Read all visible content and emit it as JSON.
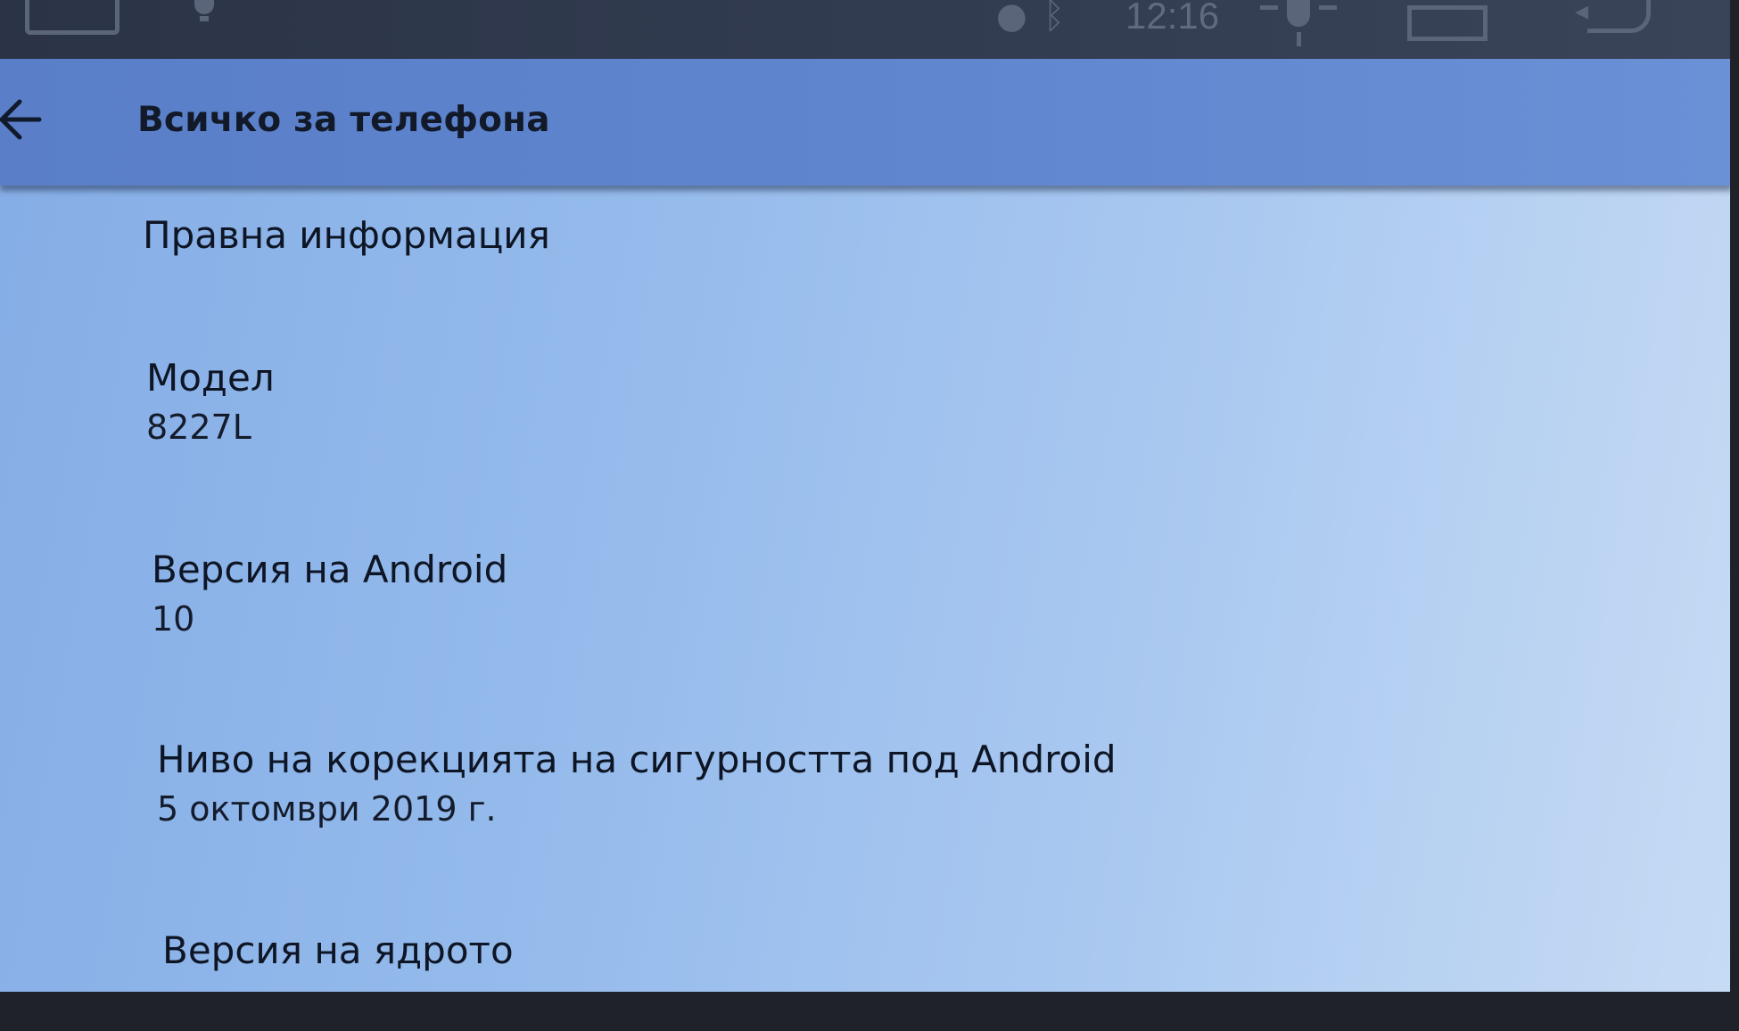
{
  "status_bar": {
    "time": "12:16",
    "icons": [
      "home-icon",
      "bulb-icon",
      "location-icon",
      "bluetooth-icon",
      "brightness-icon",
      "window-icon",
      "back-arrow-icon"
    ]
  },
  "app_bar": {
    "back_icon": "arrow-left-icon",
    "title": "Всичко за телефона"
  },
  "preferences": [
    {
      "title": "Правна информация",
      "summary": ""
    },
    {
      "title": "Модел",
      "summary": "8227L"
    },
    {
      "title": "Версия на Android",
      "summary": "10"
    },
    {
      "title": "Ниво на корекцията на сигурността под Android",
      "summary": "5 октомври 2019 г."
    },
    {
      "title": "Версия на ядрото",
      "summary": ""
    }
  ],
  "colors": {
    "status_bar": "#2b3446",
    "app_bar": "#5f85cf",
    "content_left": "#86aee6",
    "content_right": "#c6dbf4",
    "text": "#0e1524"
  }
}
